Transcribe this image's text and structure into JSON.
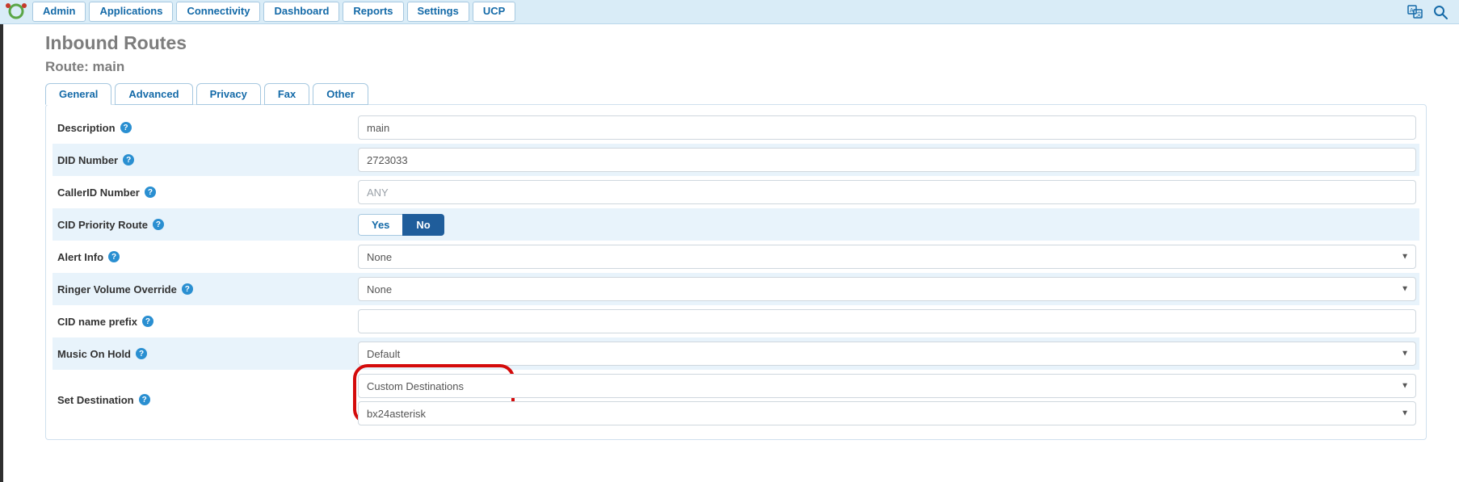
{
  "nav": {
    "items": [
      "Admin",
      "Applications",
      "Connectivity",
      "Dashboard",
      "Reports",
      "Settings",
      "UCP"
    ]
  },
  "page": {
    "title": "Inbound Routes",
    "subtitle": "Route: main"
  },
  "tabs": [
    "General",
    "Advanced",
    "Privacy",
    "Fax",
    "Other"
  ],
  "active_tab_index": 0,
  "form": {
    "description": {
      "label": "Description",
      "value": "main"
    },
    "did_number": {
      "label": "DID Number",
      "value": "2723033"
    },
    "callerid": {
      "label": "CallerID Number",
      "placeholder": "ANY",
      "value": ""
    },
    "cid_priority": {
      "label": "CID Priority Route",
      "options": [
        "Yes",
        "No"
      ],
      "selected": "No"
    },
    "alert_info": {
      "label": "Alert Info",
      "value": "None"
    },
    "ringer_vol": {
      "label": "Ringer Volume Override",
      "value": "None"
    },
    "cid_prefix": {
      "label": "CID name prefix",
      "value": ""
    },
    "moh": {
      "label": "Music On Hold",
      "value": "Default"
    },
    "destination": {
      "label": "Set Destination",
      "category": "Custom Destinations",
      "target": "bx24asterisk"
    }
  }
}
